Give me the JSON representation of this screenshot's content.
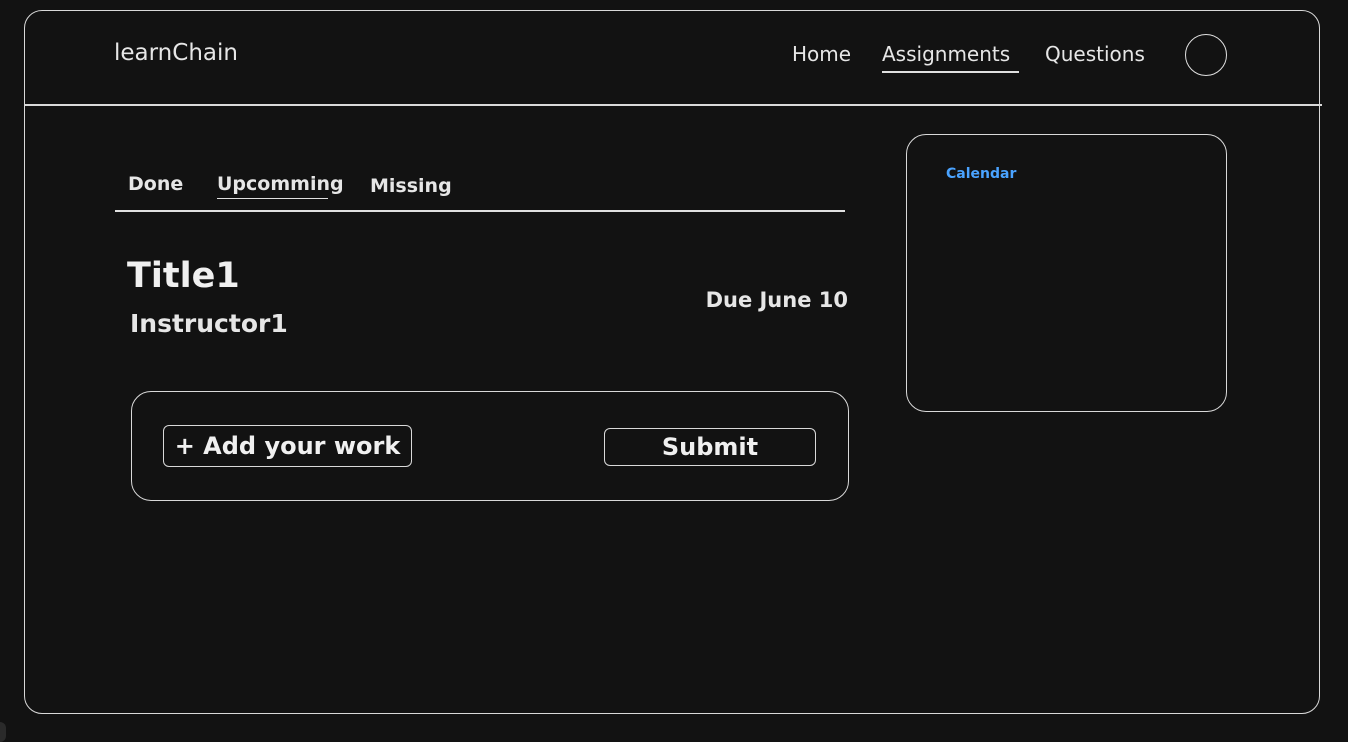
{
  "app": {
    "logo": "learnChain"
  },
  "nav": {
    "home": "Home",
    "assignments": "Assignments",
    "questions": "Questions"
  },
  "tabs": {
    "done": "Done",
    "upcoming": "Upcomming",
    "missing": "Missing",
    "active": "Upcomming"
  },
  "assignment": {
    "title": "Title1",
    "instructor": "Instructor1",
    "due": "Due June 10"
  },
  "work": {
    "add_label": "+ Add your work",
    "submit_label": "Submit"
  },
  "calendar": {
    "label": "Calendar",
    "label_color": "#4aa3ff"
  },
  "colors": {
    "background": "#121212",
    "stroke": "#d9d9d9",
    "text": "#e6e6e6"
  }
}
